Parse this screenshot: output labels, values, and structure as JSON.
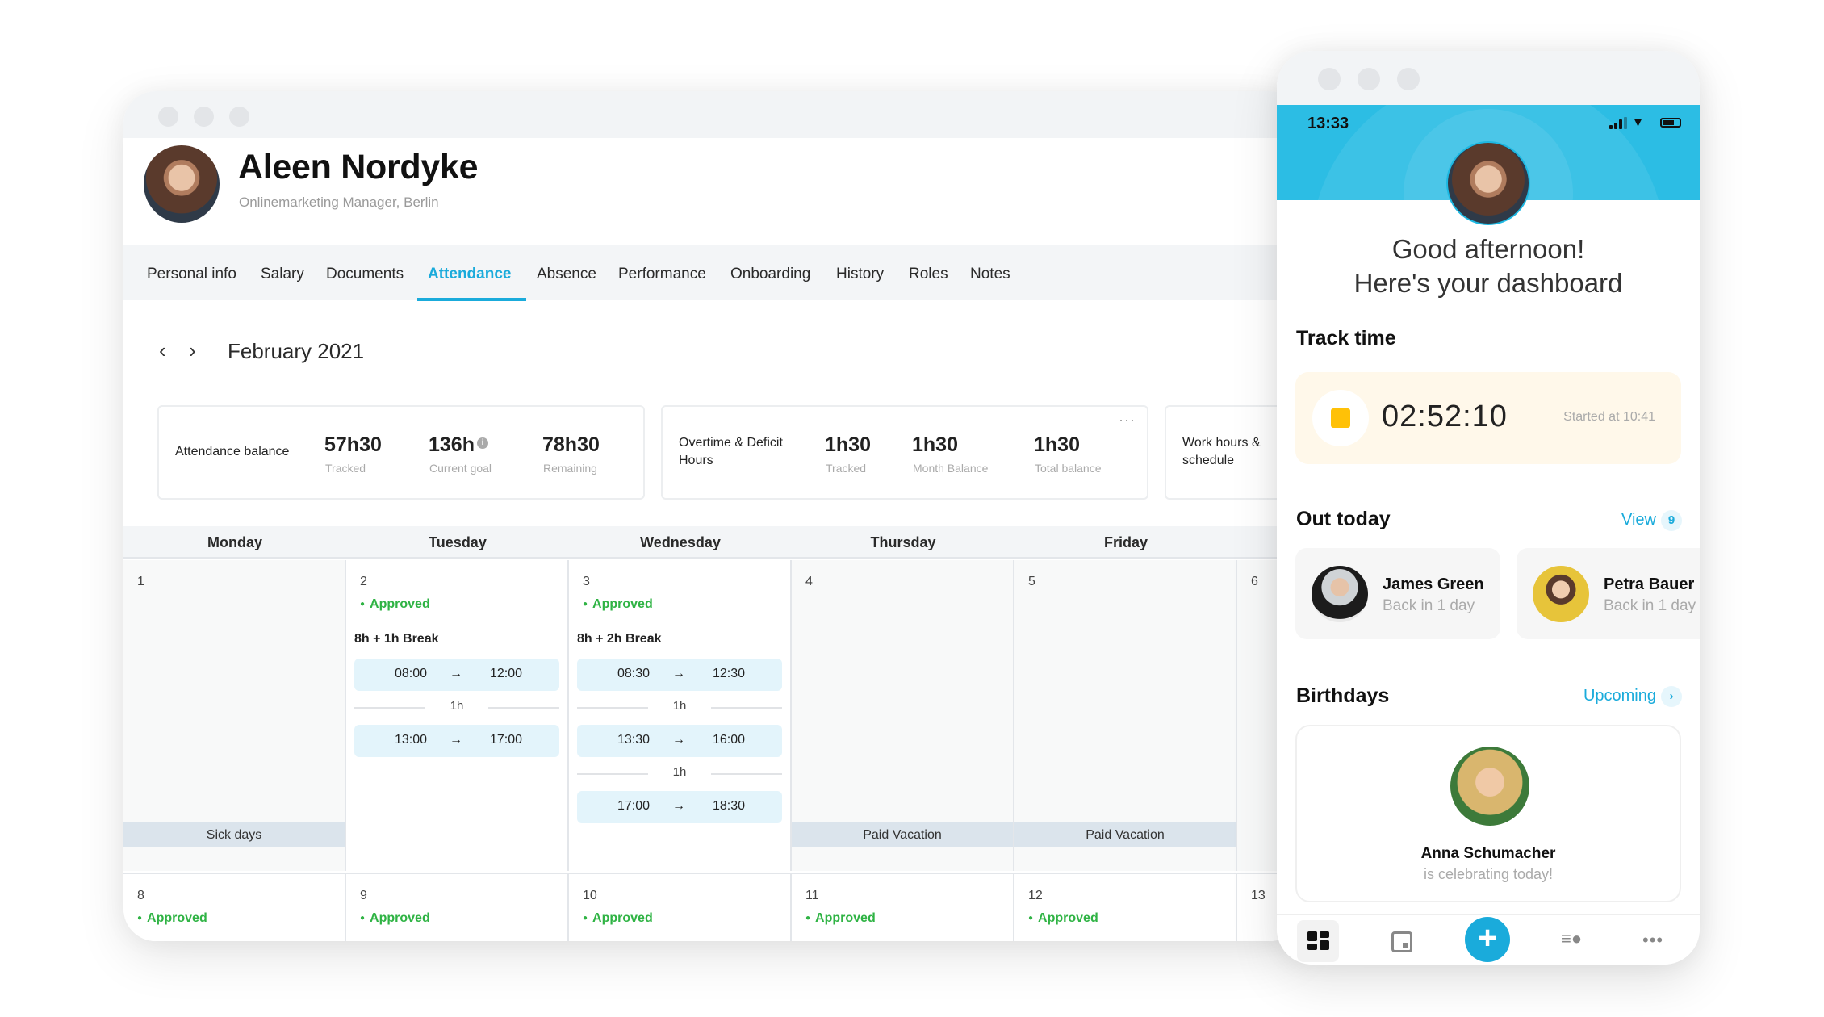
{
  "desktop": {
    "profile": {
      "name": "Aleen Nordyke",
      "role": "Onlinemarketing Manager, Berlin"
    },
    "tabs": [
      {
        "label": "Personal info",
        "active": false
      },
      {
        "label": "Salary",
        "active": false
      },
      {
        "label": "Documents",
        "active": false
      },
      {
        "label": "Attendance",
        "active": true
      },
      {
        "label": "Absence",
        "active": false
      },
      {
        "label": "Performance",
        "active": false
      },
      {
        "label": "Onboarding",
        "active": false
      },
      {
        "label": "History",
        "active": false
      },
      {
        "label": "Roles",
        "active": false
      },
      {
        "label": "Notes",
        "active": false
      }
    ],
    "month_nav": {
      "prev_icon": "chevron-left",
      "next_icon": "chevron-right",
      "month": "February 2021"
    },
    "summary_cards": {
      "attendance": {
        "title": "Attendance balance",
        "stats": [
          {
            "value": "57h30",
            "label": "Tracked"
          },
          {
            "value": "136h",
            "label": "Current goal",
            "info_icon": true
          },
          {
            "value": "78h30",
            "label": "Remaining"
          }
        ]
      },
      "overtime": {
        "title": "Overtime & Deficit Hours",
        "more": "···",
        "stats": [
          {
            "value": "1h30",
            "label": "Tracked"
          },
          {
            "value": "1h30",
            "label": "Month Balance"
          },
          {
            "value": "1h30",
            "label": "Total balance"
          }
        ]
      },
      "schedule": {
        "title": "Work hours & schedule"
      }
    },
    "calendar": {
      "day_names": [
        "Monday",
        "Tuesday",
        "Wednesday",
        "Thursday",
        "Friday"
      ],
      "status_approved": "Approved",
      "week1": [
        {
          "day": "1",
          "absence": "Sick days"
        },
        {
          "day": "2",
          "status": "Approved",
          "summary": "8h + 1h Break",
          "slots": [
            {
              "start": "08:00",
              "end": "12:00"
            },
            {
              "start": "13:00",
              "end": "17:00"
            }
          ],
          "breaks": [
            "1h"
          ]
        },
        {
          "day": "3",
          "status": "Approved",
          "summary": "8h + 2h Break",
          "slots": [
            {
              "start": "08:30",
              "end": "12:30"
            },
            {
              "start": "13:30",
              "end": "16:00"
            },
            {
              "start": "17:00",
              "end": "18:30"
            }
          ],
          "breaks": [
            "1h",
            "1h"
          ]
        },
        {
          "day": "4",
          "absence": "Paid Vacation"
        },
        {
          "day": "5",
          "absence": "Paid Vacation"
        },
        {
          "day": "6"
        }
      ],
      "week2": [
        {
          "day": "8",
          "status": "Approved"
        },
        {
          "day": "9",
          "status": "Approved"
        },
        {
          "day": "10",
          "status": "Approved"
        },
        {
          "day": "11",
          "status": "Approved"
        },
        {
          "day": "12",
          "status": "Approved"
        },
        {
          "day": "13"
        }
      ],
      "arrow": "→"
    }
  },
  "mobile": {
    "status_bar": {
      "time": "13:33"
    },
    "greeting_line1": "Good afternoon!",
    "greeting_line2": "Here's your dashboard",
    "track_time": {
      "title": "Track time",
      "timer": "02:52:10",
      "started": "Started at 10:41"
    },
    "out_today": {
      "title": "Out today",
      "view_label": "View",
      "count": "9",
      "people": [
        {
          "name": "James Green",
          "status": "Back in 1 day"
        },
        {
          "name": "Petra Bauer",
          "status": "Back in 1 day"
        }
      ]
    },
    "birthdays": {
      "title": "Birthdays",
      "upcoming_label": "Upcoming",
      "chevron": "›",
      "person": {
        "name": "Anna Schumacher",
        "note": "is celebrating today!"
      }
    },
    "tabbar": {
      "items": [
        "dashboard",
        "calendar",
        "add",
        "people",
        "more"
      ],
      "add_label": "+",
      "more_label": "•••"
    }
  },
  "colors": {
    "accent": "#1aabdb",
    "approved": "#2fb344",
    "header_blue": "#1db8e2",
    "timer_bg": "#fff8ea",
    "stop": "#ffc107"
  }
}
